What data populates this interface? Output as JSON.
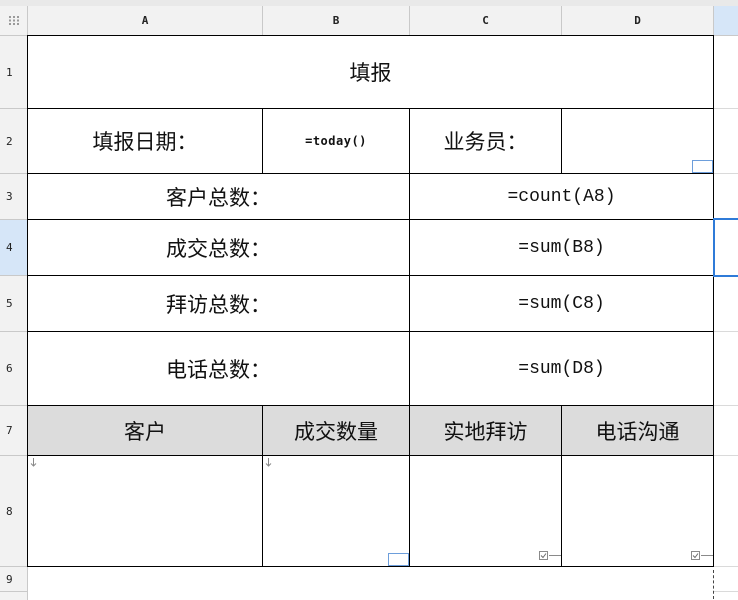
{
  "sheet": {
    "columns": [
      "A",
      "B",
      "C",
      "D"
    ],
    "rows": [
      "1",
      "2",
      "3",
      "4",
      "5",
      "6",
      "7",
      "8",
      "9"
    ]
  },
  "report": {
    "title": "填报",
    "date_label": "填报日期：",
    "date_formula": "=today()",
    "salesperson_label": "业务员：",
    "summary": [
      {
        "label": "客户总数：",
        "formula": "=count(A8)"
      },
      {
        "label": "成交总数：",
        "formula": "=sum(B8)"
      },
      {
        "label": "拜访总数：",
        "formula": "=sum(C8)"
      },
      {
        "label": "电话总数：",
        "formula": "=sum(D8)"
      }
    ],
    "table_headers": [
      "客户",
      "成交数量",
      "实地拜访",
      "电话沟通"
    ]
  },
  "icons": {
    "corner": "grip-icon",
    "expand": "expand-down-icon",
    "widget": "widget-indicator-icon",
    "checkbox": "checkbox-widget-icon"
  },
  "colors": {
    "grid_header": "#f2f2f2",
    "grid_line": "#c9c9c9",
    "header_highlight": "#d6e6f8",
    "selection": "#2f7bd8",
    "table_border": "#000000",
    "table_header_fill": "#dcdcdc",
    "widget_outline": "#6d9edb"
  }
}
